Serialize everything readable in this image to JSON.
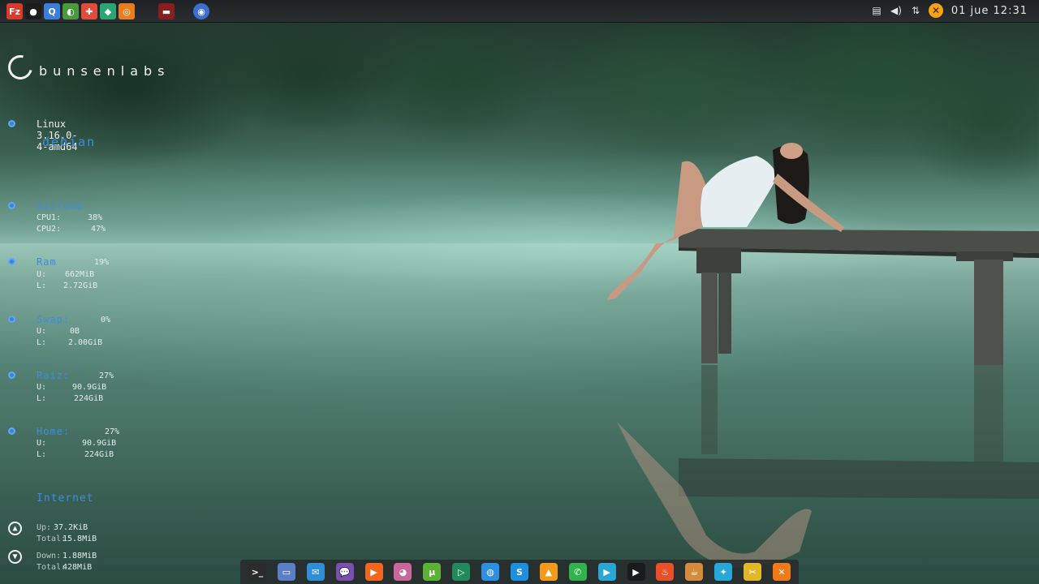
{
  "top_panel": {
    "launchers": [
      {
        "icon": "filezilla-icon",
        "glyph": "Fz",
        "color": "#d93a2b"
      },
      {
        "icon": "camera-icon",
        "glyph": "●",
        "color": "#1c1c1c"
      },
      {
        "icon": "search-icon",
        "glyph": "Q",
        "color": "#3a7fd9"
      },
      {
        "icon": "browser-icon",
        "glyph": "◐",
        "color": "#4a9a3c"
      },
      {
        "icon": "help-icon",
        "glyph": "✚",
        "color": "#e24a3a"
      },
      {
        "icon": "graphics-icon",
        "glyph": "◆",
        "color": "#2aa673"
      },
      {
        "icon": "blender-icon",
        "glyph": "◎",
        "color": "#e87d1e"
      },
      {
        "icon": "terminal-icon",
        "glyph": "▬",
        "color": "#8a1d1d"
      },
      {
        "icon": "globe-icon",
        "glyph": "◉",
        "color": "#3a6fd0"
      }
    ],
    "tray": [
      {
        "icon": "clipboard-icon",
        "glyph": "▤"
      },
      {
        "icon": "volume-icon",
        "glyph": "◀)"
      },
      {
        "icon": "network-icon",
        "glyph": "⇅"
      },
      {
        "icon": "xchat-icon",
        "glyph": "✕"
      }
    ],
    "clock": "01 jue 12:31"
  },
  "conky": {
    "logo": "bunsenlabs",
    "kernel": "Linux 3.16.0-4-amd64",
    "distro": "debian",
    "sistema": {
      "title": "Sistema",
      "cpu1_label": "CPU1:",
      "cpu1": "38%",
      "cpu2_label": "CPU2:",
      "cpu2": "47%"
    },
    "ram": {
      "title": "Ram",
      "pct": "19%",
      "u_label": "U:",
      "u": "662MiB",
      "l_label": "L:",
      "l": "2.72GiB"
    },
    "swap": {
      "title": "Swap:",
      "pct": "0%",
      "u_label": "U:",
      "u": "0B",
      "l_label": "L:",
      "l": "2.00GiB"
    },
    "raiz": {
      "title": "Raiz:",
      "pct": "27%",
      "u_label": "U:",
      "u": "90.9GiB",
      "l_label": "L:",
      "l": "224GiB"
    },
    "home": {
      "title": "Home:",
      "pct": "27%",
      "u_label": "U:",
      "u": "90.9GiB",
      "l_label": "L:",
      "l": "224GiB"
    },
    "internet": {
      "title": "Internet",
      "up_label": "Up:",
      "up": "37.2KiB",
      "up_total_label": "Total:",
      "up_total": "15.8MiB",
      "down_label": "Down:",
      "down": "1.88MiB",
      "down_total_label": "Total:",
      "down_total": "428MiB"
    }
  },
  "dock": [
    {
      "icon": "terminal-icon",
      "glyph": ">_",
      "color": "#2b2b2b"
    },
    {
      "icon": "files-icon",
      "glyph": "▭",
      "color": "#5a7fc7"
    },
    {
      "icon": "mail-icon",
      "glyph": "✉",
      "color": "#2f8fd6"
    },
    {
      "icon": "chat-icon",
      "glyph": "💬",
      "color": "#7a4fb0"
    },
    {
      "icon": "media-icon",
      "glyph": "▶",
      "color": "#f2661e"
    },
    {
      "icon": "pidgin-icon",
      "glyph": "◕",
      "color": "#c7679a"
    },
    {
      "icon": "utorrent-icon",
      "glyph": "µ",
      "color": "#5bb335"
    },
    {
      "icon": "play-icon",
      "glyph": "▷",
      "color": "#1f8a5a"
    },
    {
      "icon": "web-browser-icon",
      "glyph": "◍",
      "color": "#2d8fe0"
    },
    {
      "icon": "skype-icon",
      "glyph": "S",
      "color": "#1d8fe0"
    },
    {
      "icon": "vlc-icon",
      "glyph": "▲",
      "color": "#f39a1a"
    },
    {
      "icon": "whatsapp-icon",
      "glyph": "✆",
      "color": "#2fb34a"
    },
    {
      "icon": "video-icon",
      "glyph": "▶",
      "color": "#2aa6d6"
    },
    {
      "icon": "player-icon",
      "glyph": "▶",
      "color": "#1b1b1b"
    },
    {
      "icon": "fire-icon",
      "glyph": "♨",
      "color": "#e8502a"
    },
    {
      "icon": "tea-icon",
      "glyph": "☕",
      "color": "#d58a3c"
    },
    {
      "icon": "kodi-icon",
      "glyph": "✦",
      "color": "#28a8d8"
    },
    {
      "icon": "tools-icon",
      "glyph": "✂",
      "color": "#e2b82a"
    },
    {
      "icon": "xchat-dock-icon",
      "glyph": "✕",
      "color": "#f07a1a"
    }
  ]
}
